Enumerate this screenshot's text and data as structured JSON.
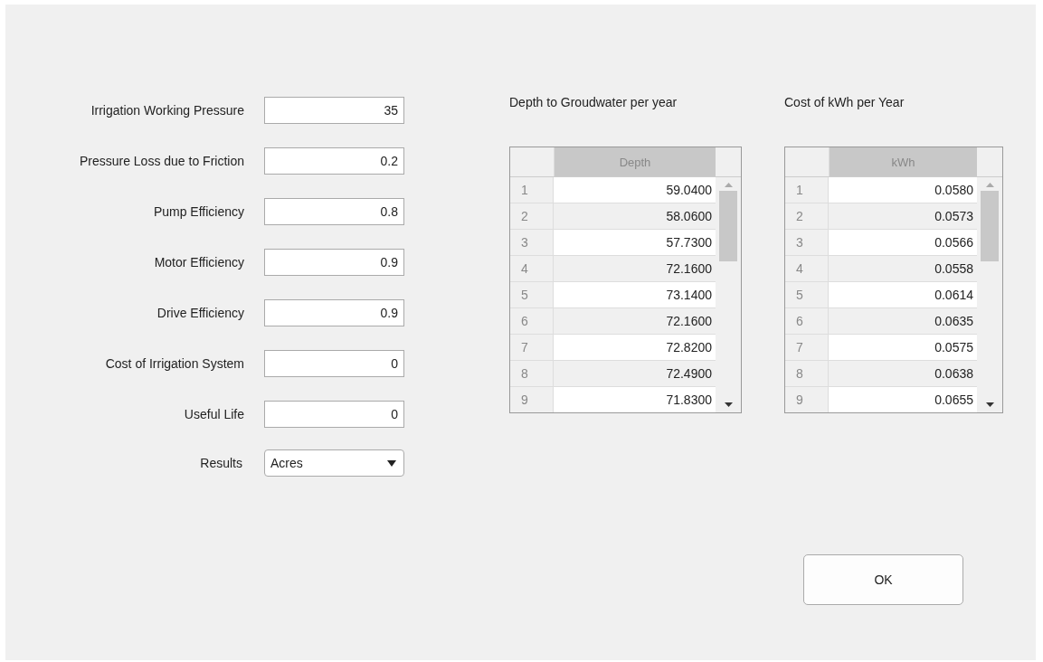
{
  "fields": [
    {
      "label": "Irrigation Working Pressure",
      "value": "35"
    },
    {
      "label": "Pressure Loss due to Friction",
      "value": "0.2"
    },
    {
      "label": "Pump Efficiency",
      "value": "0.8"
    },
    {
      "label": "Motor Efficiency",
      "value": "0.9"
    },
    {
      "label": "Drive Efficiency",
      "value": "0.9"
    },
    {
      "label": "Cost of Irrigation System",
      "value": "0"
    },
    {
      "label": "Useful Life",
      "value": "0"
    }
  ],
  "results": {
    "label": "Results",
    "value": "Acres"
  },
  "tables": [
    {
      "title": "Depth to Groudwater per year",
      "column": "Depth",
      "rows": [
        [
          "1",
          "59.0400"
        ],
        [
          "2",
          "58.0600"
        ],
        [
          "3",
          "57.7300"
        ],
        [
          "4",
          "72.1600"
        ],
        [
          "5",
          "73.1400"
        ],
        [
          "6",
          "72.1600"
        ],
        [
          "7",
          "72.8200"
        ],
        [
          "8",
          "72.4900"
        ],
        [
          "9",
          "71.8300"
        ]
      ]
    },
    {
      "title": "Cost of kWh per Year",
      "column": "kWh",
      "rows": [
        [
          "1",
          "0.0580"
        ],
        [
          "2",
          "0.0573"
        ],
        [
          "3",
          "0.0566"
        ],
        [
          "4",
          "0.0558"
        ],
        [
          "5",
          "0.0614"
        ],
        [
          "6",
          "0.0635"
        ],
        [
          "7",
          "0.0575"
        ],
        [
          "8",
          "0.0638"
        ],
        [
          "9",
          "0.0655"
        ]
      ]
    }
  ],
  "ok_button": "OK"
}
